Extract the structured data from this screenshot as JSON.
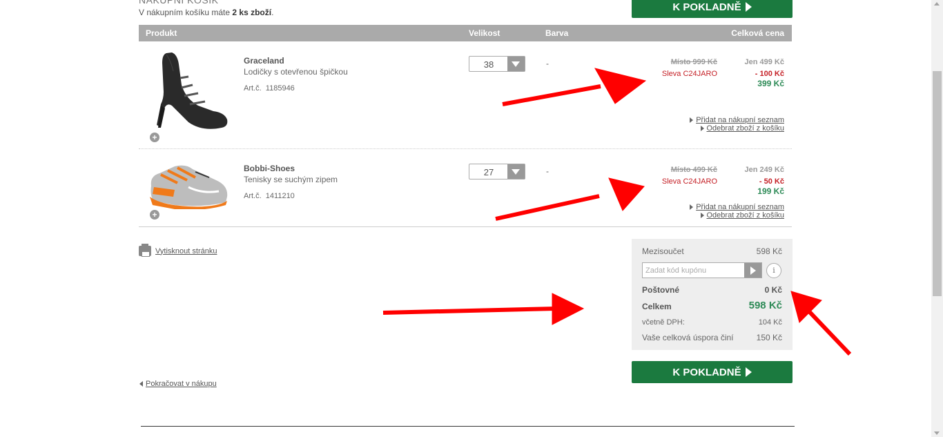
{
  "header": {
    "title": "NÁKUPNÍ KOŠÍK",
    "subtitle_prefix": "V nákupním košíku máte ",
    "subtitle_count": "2 ks zboží",
    "subtitle_suffix": "."
  },
  "checkout_label": "K POKLADNĚ",
  "table_headers": {
    "product": "Produkt",
    "size": "Velikost",
    "color": "Barva",
    "total": "Celková cena"
  },
  "items": [
    {
      "name": "Graceland",
      "description": "Lodičky s otevřenou špičkou",
      "art_label": "Art.č.",
      "art_number": "1185946",
      "size": "38",
      "color": "-",
      "price_old": "Místo 999 Kč",
      "price_only": "Jen 499 Kč",
      "discount_label": "Sleva C24JARO",
      "discount_value": "- 100 Kč",
      "price_final": "399 Kč",
      "add_to_list": "Přidat na nákupní seznam",
      "remove": "Odebrat zboží z košíku"
    },
    {
      "name": "Bobbi-Shoes",
      "description": "Tenisky se suchým zipem",
      "art_label": "Art.č.",
      "art_number": "1411210",
      "size": "27",
      "color": "-",
      "price_old": "Místo 499 Kč",
      "price_only": "Jen 249 Kč",
      "discount_label": "Sleva C24JARO",
      "discount_value": "- 50 Kč",
      "price_final": "199 Kč",
      "add_to_list": "Přidat na nákupní seznam",
      "remove": "Odebrat zboží z košíku"
    }
  ],
  "print_link": "Vytisknout stránku",
  "continue_link": "Pokračovat v nákupu",
  "summary": {
    "subtotal_label": "Mezisoučet",
    "subtotal_value": "598 Kč",
    "coupon_placeholder": "Zadat kód kupónu",
    "info_icon": "i",
    "shipping_label": "Poštovné",
    "shipping_value": "0 Kč",
    "total_label": "Celkem",
    "total_value": "598 Kč",
    "vat_label": "včetně DPH:",
    "vat_value": "104 Kč",
    "savings_label": "Vaše celková úspora činí",
    "savings_value": "150 Kč"
  },
  "colors": {
    "accent_green": "#1b7a3f",
    "price_green": "#2e8b57",
    "discount_red": "#c41e24",
    "header_gray": "#aaaaaa",
    "annotation_arrow": "#ff0000"
  },
  "icons": [
    "arrow-right-icon",
    "chevron-down-icon",
    "plus-icon",
    "printer-icon",
    "info-icon",
    "triangle-right-icon",
    "triangle-left-icon"
  ]
}
